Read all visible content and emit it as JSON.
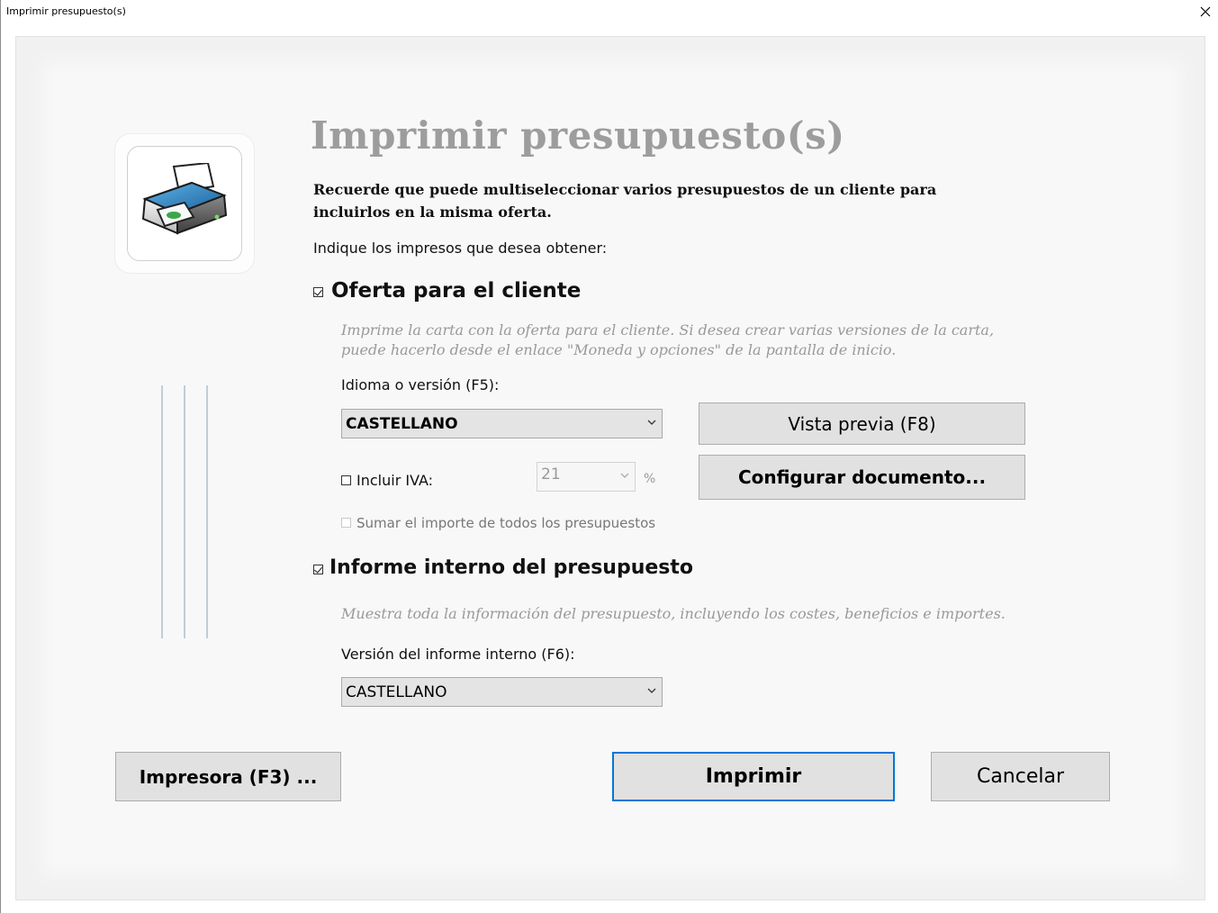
{
  "window": {
    "title": "Imprimir presupuesto(s)"
  },
  "icons": {
    "close": "close-icon",
    "printer": "printer-icon",
    "dropdown": "chevron-down-icon"
  },
  "colors": {
    "accent": "#0078d7",
    "heading": "#9d9d9d",
    "description": "#999999",
    "button_bg": "#e1e1e1"
  },
  "main": {
    "heading": "Imprimir presupuesto(s)",
    "reminder": "Recuerde que puede multiseleccionar varios presupuestos de un cliente para incluirlos en la misma oferta.",
    "instructions": "Indique los impresos que desea obtener:"
  },
  "oferta": {
    "checked": true,
    "title": "Oferta para el cliente",
    "description": "Imprime la carta con la oferta para el cliente. Si desea crear varias versiones de la carta, puede hacerlo desde el enlace \"Moneda y opciones\" de la pantalla de inicio.",
    "idioma_label": "Idioma o versión (F5):",
    "idioma_value": "CASTELLANO",
    "preview_button": "Vista previa (F8)",
    "configure_button": "Configurar documento...",
    "iva_checked": false,
    "iva_label": "Incluir IVA:",
    "iva_value": "21",
    "iva_unit": "%",
    "sum_checked": false,
    "sum_label": "Sumar el importe de todos los presupuestos"
  },
  "informe": {
    "checked": true,
    "title": "Informe interno del presupuesto",
    "description": "Muestra toda la información del presupuesto, incluyendo los costes, beneficios e importes.",
    "version_label": "Versión del informe interno (F6):",
    "version_value": "CASTELLANO"
  },
  "footer": {
    "printer_button": "Impresora (F3) ...",
    "print_button": "Imprimir",
    "cancel_button": "Cancelar"
  }
}
